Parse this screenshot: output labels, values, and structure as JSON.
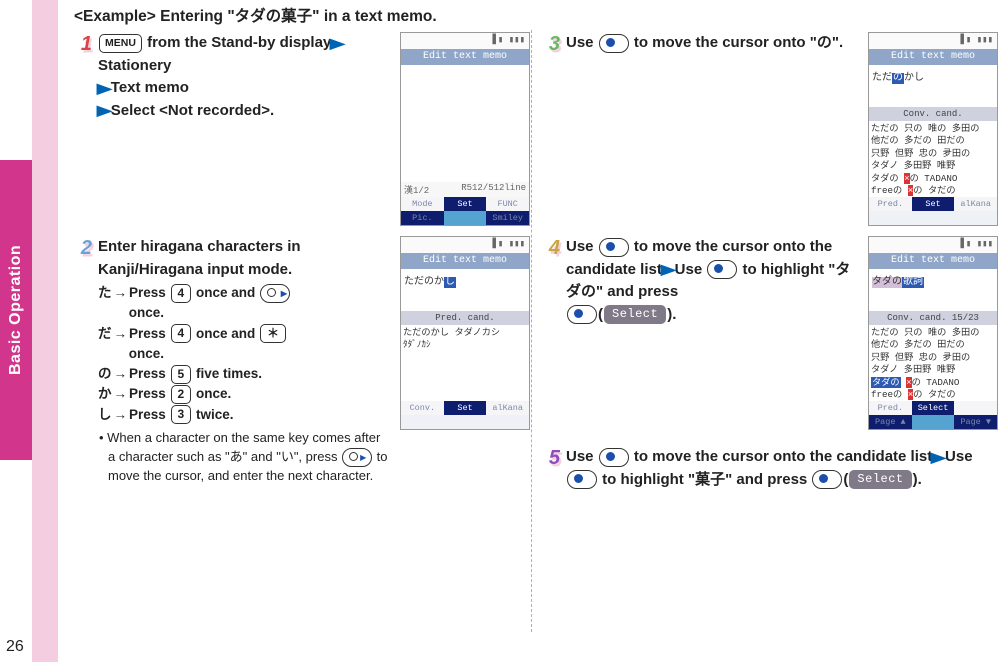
{
  "page_number": "26",
  "side_tab": "Basic Operation",
  "title": "<Example> Entering \"タダの菓子\" in a text memo.",
  "steps": {
    "s1": {
      "num": "1",
      "menu": "MENU",
      "l1a": " from the Stand-by display",
      "l1b": "Stationery",
      "l2": "Text memo",
      "l3": "Select <Not recorded>."
    },
    "s2": {
      "num": "2",
      "head": "Enter hiragana characters in Kanji/Hiragana input mode.",
      "r1a": "た",
      "r1b": "Press ",
      "r1c": " once and ",
      "r1d": " once.",
      "r2a": "だ",
      "r2b": "Press ",
      "r2c": " once and ",
      "r2d": " once.",
      "r3a": "の",
      "r3b": "Press ",
      "r3c": " five times.",
      "r4a": "か",
      "r4b": "Press ",
      "r4c": " once.",
      "r5a": "し",
      "r5b": "Press ",
      "r5c": " twice.",
      "note": "• When a character on the same key comes after a character such as \"あ\" and \"い\", press ",
      "note2": " to move the cursor, and enter the next character.",
      "k4": "4",
      "kstar": "＊",
      "k5": "5",
      "k2": "2",
      "k3": "3"
    },
    "s3": {
      "num": "3",
      "l1a": "Use ",
      "l1b": " to move the cursor onto \"",
      "l1c": "の",
      "l1d": "\"."
    },
    "s4": {
      "num": "4",
      "l1a": "Use ",
      "l1b": " to move the cursor onto the candidate list",
      "l1c": "Use ",
      "l1d": " to highlight \"",
      "l1e": "タダの",
      "l1f": "\" and press ",
      "l1g": "(",
      "l1h": "Select",
      "l1i": ")."
    },
    "s5": {
      "num": "5",
      "l1a": "Use ",
      "l1b": " to move the cursor onto the candidate list",
      "l1c": "Use ",
      "l1d": " to highlight \"",
      "l1e": "菓子",
      "l1f": "\" and press ",
      "l1g": "(",
      "l1h": "Select",
      "l1i": ")."
    }
  },
  "phone1": {
    "head": "Edit text memo",
    "status_left": "漢1/2",
    "status_right": "R512/512line",
    "f1": "Mode",
    "f2": "Set",
    "f3": "FUNC",
    "f4": "Pic.",
    "f5": "",
    "f6": "Smiley"
  },
  "phone2": {
    "head": "Edit text memo",
    "body": "ただのか",
    "bodysel": "し",
    "cand_head": "Pred. cand.",
    "cand": "ただのかし タダノカシ\nﾀﾀﾞﾉｶｼ",
    "f1": "Conv.",
    "f2": "Set",
    "f3": "alKana"
  },
  "phone3": {
    "head": "Edit text memo",
    "body": "ただ",
    "bodysel": "の",
    "body2": "かし",
    "cand_head": "Conv. cand.",
    "cand": "ただの 只の 唯の 多田の\n他だの 多だの 田だの\n只野 但野 忠の 夛田の\nタダノ 多田野 唯野\nタダの ",
    "cand_x": "×",
    "cand2": "の TADANO\nfreeの ",
    "cand3": "の タだの",
    "f1": "Pred.",
    "f2": "Set",
    "f3": "alKana"
  },
  "phone4": {
    "head": "Edit text memo",
    "body_a": "タダの",
    "body_b": "歌詞",
    "cand_head": "Conv. cand.      15/23",
    "cand": "ただの 只の 唯の 多田の\n他だの 多だの 田だの\n只野 但野 忠の 夛田の\nタダノ 多田野 唯野\n",
    "cand_sel": "タダの",
    "cand2": " ",
    "cand3": "の TADANO\nfreeの ",
    "cand4": "の タだの",
    "f1": "Pred.",
    "f2": "Select",
    "f3": "",
    "f4": "Page ▲",
    "f5": "",
    "f6": "Page ▼"
  }
}
